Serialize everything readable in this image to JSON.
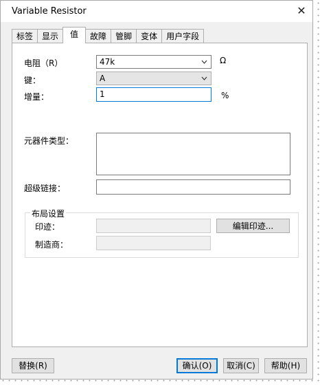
{
  "window": {
    "title": "Variable Resistor",
    "close_glyph": "✕"
  },
  "tabs": [
    {
      "label": "标签"
    },
    {
      "label": "显示"
    },
    {
      "label": "值"
    },
    {
      "label": "故障"
    },
    {
      "label": "管脚"
    },
    {
      "label": "变体"
    },
    {
      "label": "用户字段"
    }
  ],
  "active_tab": "值",
  "form": {
    "resistance_label": "电阻（R）",
    "resistance_value": "47k",
    "resistance_unit": "Ω",
    "key_label": "键：",
    "key_value": "A",
    "increment_label": "增量：",
    "increment_value": "1",
    "increment_unit": "%",
    "component_type_label": "元器件类型：",
    "hyperlink_label": "超级链接：",
    "layout_group_title": "布局设置",
    "footprint_label": "印迹：",
    "manufacturer_label": "制造商：",
    "edit_footprint_label": "编辑印迹..."
  },
  "footer": {
    "replace_label": "替换(R)",
    "ok_label": "确认(O)",
    "cancel_label": "取消(C)",
    "help_label": "帮助(H)"
  },
  "colors": {
    "dialog_bg": "#f0f0f0",
    "accent": "#0078d7"
  },
  "icons": {
    "close": "close-icon",
    "dropdown": "chevron-down-icon"
  }
}
